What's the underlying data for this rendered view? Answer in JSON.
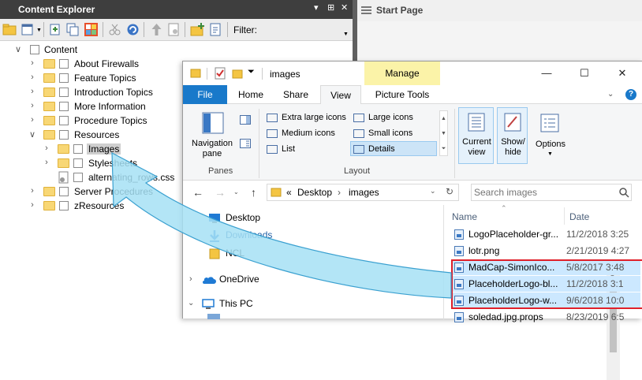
{
  "content_explorer": {
    "title": "Content Explorer",
    "title_glyphs": [
      "▾",
      "⊞",
      "✕"
    ],
    "filter_label": "Filter:",
    "filter_value": "",
    "tree": [
      {
        "label": "Content",
        "chevron": "∨",
        "has_folder": false
      },
      {
        "label": "About Firewalls",
        "chevron": "›",
        "has_folder": true
      },
      {
        "label": "Feature Topics",
        "chevron": "›",
        "has_folder": true
      },
      {
        "label": "Introduction Topics",
        "chevron": "›",
        "has_folder": true
      },
      {
        "label": "More Information",
        "chevron": "›",
        "has_folder": true
      },
      {
        "label": "Procedure Topics",
        "chevron": "›",
        "has_folder": true
      },
      {
        "label": "Resources",
        "chevron": "∨",
        "has_folder": true
      },
      {
        "label": "Images",
        "chevron": "›",
        "has_folder": true,
        "highlighted": true
      },
      {
        "label": "Stylesheets",
        "chevron": "›",
        "has_folder": true
      },
      {
        "label": "alternating_rows.css",
        "chevron": "",
        "has_folder": false,
        "is_file": true
      },
      {
        "label": "Server Procedures",
        "chevron": "›",
        "has_folder": true
      },
      {
        "label": "zResources",
        "chevron": "›",
        "has_folder": true
      }
    ]
  },
  "start_page": {
    "title": "Start Page"
  },
  "file_explorer": {
    "title": "images",
    "manage_tab": "Manage",
    "window_buttons": [
      "—",
      "☐",
      "✕"
    ],
    "tabs": [
      "File",
      "Home",
      "Share",
      "View",
      "Picture Tools"
    ],
    "active_tab": "View",
    "ribbon": {
      "navigation_pane": "Navigation\npane",
      "panes_group": "Panes",
      "layout_items": [
        "Extra large icons",
        "Large icons",
        "Medium icons",
        "Small icons",
        "List",
        "Details"
      ],
      "layout_group": "Layout",
      "current_view": "Current\nview",
      "show_hide": "Show/\nhide",
      "options": "Options"
    },
    "address": {
      "prefix": "«",
      "crumbs": [
        "Desktop",
        "images"
      ],
      "separator": "›"
    },
    "search_placeholder": "Search images",
    "nav_items": [
      {
        "label": "Desktop",
        "icon": "desktop-icon"
      },
      {
        "label": "Downloads",
        "icon": "downloads-icon"
      },
      {
        "label": "NCL",
        "icon": "folder-icon"
      },
      {
        "label": "OneDrive",
        "icon": "onedrive-icon"
      },
      {
        "label": "This PC",
        "icon": "this-pc-icon"
      }
    ],
    "columns": {
      "name": "Name",
      "date": "Date"
    },
    "files": [
      {
        "name": "LogoPlaceholder-gr...",
        "date": "11/2/2018 3:25",
        "selected": false
      },
      {
        "name": "lotr.png",
        "date": "2/21/2019 4:27",
        "selected": false
      },
      {
        "name": "MadCap-SimonIco...",
        "date": "5/8/2017 3:48",
        "selected": true
      },
      {
        "name": "PlaceholderLogo-bl...",
        "date": "11/2/2018 3:1",
        "selected": true
      },
      {
        "name": "PlaceholderLogo-w...",
        "date": "9/6/2018 10:0",
        "selected": true
      },
      {
        "name": "soledad.jpg.props",
        "date": "8/23/2019 6:5",
        "selected": false
      }
    ]
  },
  "colors": {
    "accent_blue": "#1979ca",
    "selection_blue": "#cce8ff",
    "highlight_red": "#e0202a",
    "manage_yellow": "#fbf3a8",
    "arrow_cyan": "#a6e0f5"
  }
}
